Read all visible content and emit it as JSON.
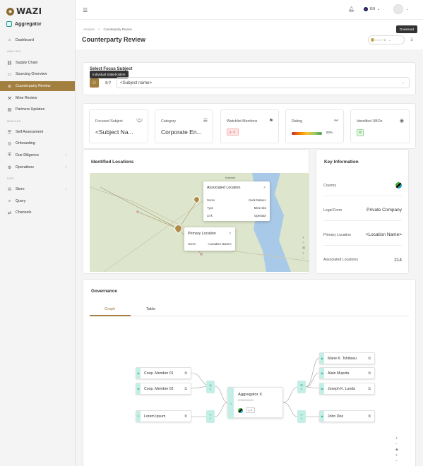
{
  "brand": {
    "logo_text": "WAZI",
    "app_name": "Aggregator"
  },
  "sidebar": {
    "dashboard": "Dashboard",
    "section_analysis": "ANALYSIS",
    "analysis_items": [
      "Supply Chain",
      "Sourcing Overview",
      "Counterparty Review",
      "Mine Review",
      "Partners Updates"
    ],
    "section_modules": "MODULES",
    "module_items": [
      "Self Assessment",
      "Onboarding",
      "Due Diligence",
      "Operations"
    ],
    "section_data": "DATA",
    "data_items": [
      "Store",
      "Query",
      "Channels"
    ],
    "active_item": "Counterparty Review"
  },
  "topbar": {
    "language": "EN"
  },
  "header": {
    "breadcrumb_parent": "Analysis",
    "breadcrumb_sep": ">",
    "breadcrumb_current": "Counterparty Review",
    "title": "Counterparty Review",
    "selector_count": "+8",
    "download_tooltip": "Download"
  },
  "focus": {
    "label": "Select Focus Subject",
    "tooltip": "Individual Stakeholders",
    "input_value": "<Subject name>"
  },
  "stats": {
    "focused_subject_label": "Focused Subject",
    "focused_subject_value": "<Subject Na...",
    "category_label": "Category",
    "category_value": "Corporate En...",
    "watchlist_label": "Watchlist Mentions",
    "watchlist_value": "2",
    "rating_label": "Rating",
    "rating_value": "90%",
    "rating_fraction": 0.9,
    "ubo_label": "Identified UBOs"
  },
  "locations": {
    "title": "Identified Locations",
    "map_place_label": "Kalemie",
    "popup_assoc": {
      "title": "Associated Location",
      "rows": [
        {
          "k": "Name",
          "v": "<Link Name>"
        },
        {
          "k": "Type",
          "v": "Mine site"
        },
        {
          "k": "Link",
          "v": "Operator"
        }
      ]
    },
    "popup_primary": {
      "title": "Primary Location",
      "rows": [
        {
          "k": "Name",
          "v": "<Location Name>"
        }
      ]
    }
  },
  "key_info": {
    "title": "Key Information",
    "country_label": "Country",
    "legal_form_label": "Legal Form",
    "legal_form_value": "Private Company",
    "primary_location_label": "Primary Location",
    "primary_location_value": "<Location Name>",
    "assoc_locations_label": "Associated Locations",
    "assoc_locations_value": "214"
  },
  "governance": {
    "title": "Governance",
    "tab_graph": "Graph",
    "tab_table": "Table",
    "center": {
      "name": "Aggregator X",
      "id": "876000000123",
      "count": "1"
    },
    "left_nodes": [
      "Coop. Member 01",
      "Coop. Member 02",
      "Lorem Ipsum"
    ],
    "right_nodes": [
      "Marie K. Tshibasu",
      "Alain Mupota",
      "Joseph K. Lunda",
      "John Doe"
    ],
    "conn_left_top": "2",
    "conn_left_bottom": "1",
    "conn_right_top": "3",
    "conn_right_bottom": "1"
  }
}
